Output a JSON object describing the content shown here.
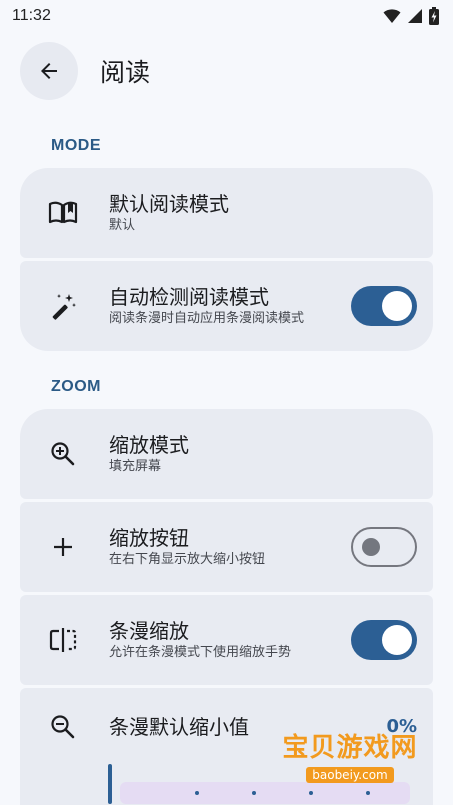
{
  "status_bar": {
    "time": "11:32"
  },
  "header": {
    "title": "阅读"
  },
  "sections": {
    "mode": {
      "label": "MODE",
      "default_mode": {
        "title": "默认阅读模式",
        "subtitle": "默认"
      },
      "auto_detect": {
        "title": "自动检测阅读模式",
        "subtitle": "阅读条漫时自动应用条漫阅读模式",
        "enabled": true
      }
    },
    "zoom": {
      "label": "ZOOM",
      "zoom_mode": {
        "title": "缩放模式",
        "subtitle": "填充屏幕"
      },
      "zoom_buttons": {
        "title": "缩放按钮",
        "subtitle": "在右下角显示放大缩小按钮",
        "enabled": false
      },
      "webtoon_zoom": {
        "title": "条漫缩放",
        "subtitle": "允许在条漫模式下使用缩放手势",
        "enabled": true
      },
      "webtoon_min_zoom": {
        "title": "条漫默认缩小值",
        "value": "0%"
      }
    }
  },
  "watermark": {
    "main": "宝贝游戏网",
    "sub": "baobeiy.com"
  },
  "colors": {
    "accent": "#2c5f94",
    "card": "#e8ebf2",
    "background": "#f6f8fc"
  }
}
